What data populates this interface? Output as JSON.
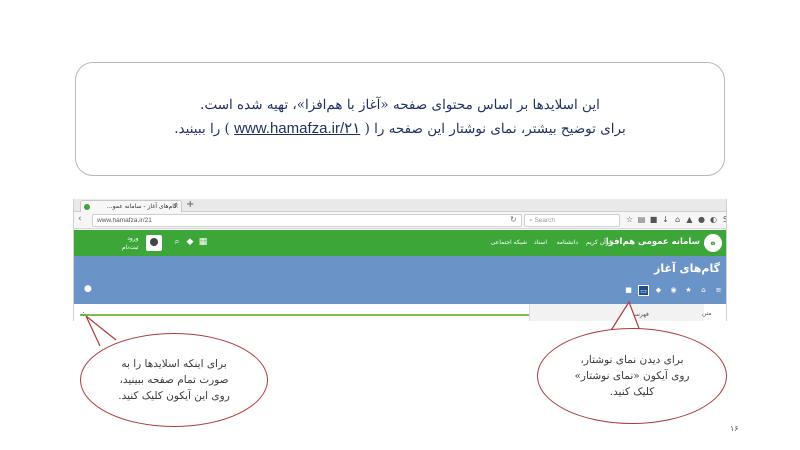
{
  "info": {
    "line1": "این اسلایدها بر اساس محتوای صفحه «آغاز با هم‌افزا»، تهیه شده است.",
    "line2_before": "برای توضیح بیشتر، نمای نوشتار این صفحه را (",
    "link": "www.hamafza.ir/۲۱",
    "line2_after": ") را ببینید."
  },
  "browser": {
    "tab_title": "گام‌های آغاز - سامانه عمو...",
    "tab_close": "×",
    "new_tab": "+",
    "url": "www.hamafza.ir/21",
    "search_placeholder": "Search"
  },
  "site": {
    "brand": "سامانه عمومی هم‌افزا",
    "nav": [
      "قرآن کریم",
      "دانشنامه",
      "اسناد",
      "شبکه اجتماعی"
    ],
    "login_line1": "ورود",
    "login_line2": "ثبت‌نام",
    "page_title": "گام‌های آغاز",
    "panel_label": "فهرست",
    "panel_label2": "متن"
  },
  "callouts": {
    "left": [
      "برای اینکه اسلایدها را به",
      "صورت تمام صفحه ببینید،",
      "روی این آیکون کلیک کنید."
    ],
    "right": [
      "برای دیدن نمای نوشتار،",
      "روی آیکون «نمای نوشتار»",
      "کلیک کنید."
    ]
  },
  "page_number": "۱۶",
  "colors": {
    "green": "#3da639",
    "blue": "#6a94c7",
    "callout_border": "#b03a3a",
    "info_text": "#1d2f5e"
  }
}
